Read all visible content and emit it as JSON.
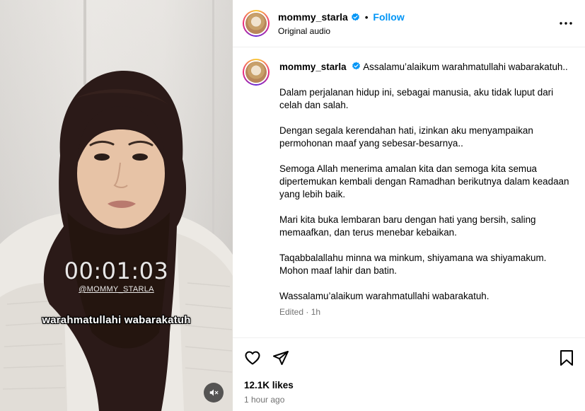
{
  "video": {
    "timer": "00:01:03",
    "handle": "@MOMMY_STARLA",
    "caption": "warahmatullahi wabarakatuh",
    "mute_icon": "speaker-muted-icon"
  },
  "header": {
    "username": "mommy_starla",
    "separator": "•",
    "follow_label": "Follow",
    "audio_label": "Original audio",
    "more_icon": "more-horizontal-icon"
  },
  "post": {
    "username": "mommy_starla",
    "first_line": "Assalamu’alaikum warahmatullahi wabarakatuh..",
    "paragraphs": [
      "Dalam perjalanan hidup ini, sebagai manusia, aku tidak luput dari celah dan salah.",
      "Dengan segala kerendahan hati, izinkan aku menyampaikan permohonan maaf yang sebesar-besarnya..",
      "Semoga Allah menerima amalan kita dan semoga kita semua dipertemukan kembali dengan Ramadhan berikutnya dalam keadaan yang lebih baik.",
      "Mari kita buka lembaran baru dengan hati yang bersih, saling memaafkan, dan terus menebar kebaikan.",
      "Taqabbalallahu minna wa minkum, shiyamana wa shiyamakum. Mohon maaf lahir dan batin.",
      "Wassalamu’alaikum warahmatullahi wabarakatuh."
    ],
    "meta": "Edited · 1h"
  },
  "actions": {
    "like_icon": "heart-icon",
    "share_icon": "send-icon",
    "save_icon": "bookmark-icon",
    "likes": "12.1K likes",
    "time": "1 hour ago"
  },
  "colors": {
    "accent": "#0095f6",
    "verified": "#0095f6",
    "muted_text": "#737373",
    "hijab": "#2b1a18"
  }
}
